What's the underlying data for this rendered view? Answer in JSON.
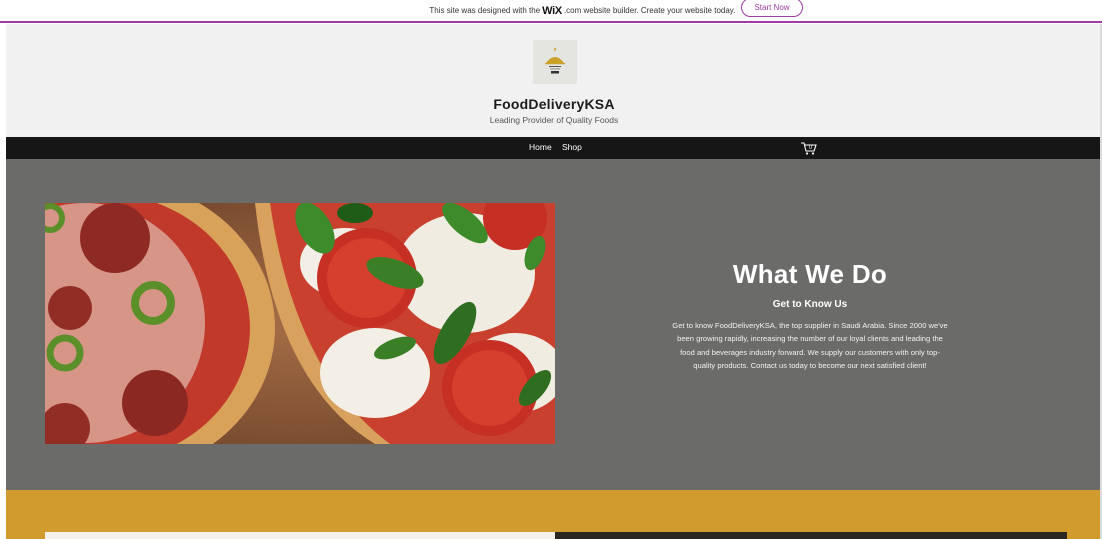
{
  "wix_banner": {
    "text_before": "This site was designed with the",
    "logo": "WiX",
    "text_after": ".com website builder. Create your website today.",
    "button": "Start Now"
  },
  "header": {
    "logo_icon": "restaurant-logo-icon",
    "title": "FoodDeliveryKSA",
    "tagline": "Leading Provider of Quality Foods"
  },
  "nav": {
    "items": [
      {
        "label": "Home"
      },
      {
        "label": "Shop"
      }
    ],
    "cart_icon": "cart-icon",
    "cart_count": "0"
  },
  "about": {
    "title": "What We Do",
    "subtitle": "Get to Know Us",
    "body": "Get to know FoodDeliveryKSA, the top supplier in Saudi Arabia. Since 2000 we've been growing rapidly, increasing the number of our loyal clients and leading the food and beverages industry forward. We supply our customers with only top-quality products. Contact us today to become our next satisfied client!"
  },
  "colors": {
    "accent": "#a23ba3",
    "nav_bg": "#161616",
    "section_grey": "#6b6b6a",
    "section_gold": "#d29b2d"
  }
}
